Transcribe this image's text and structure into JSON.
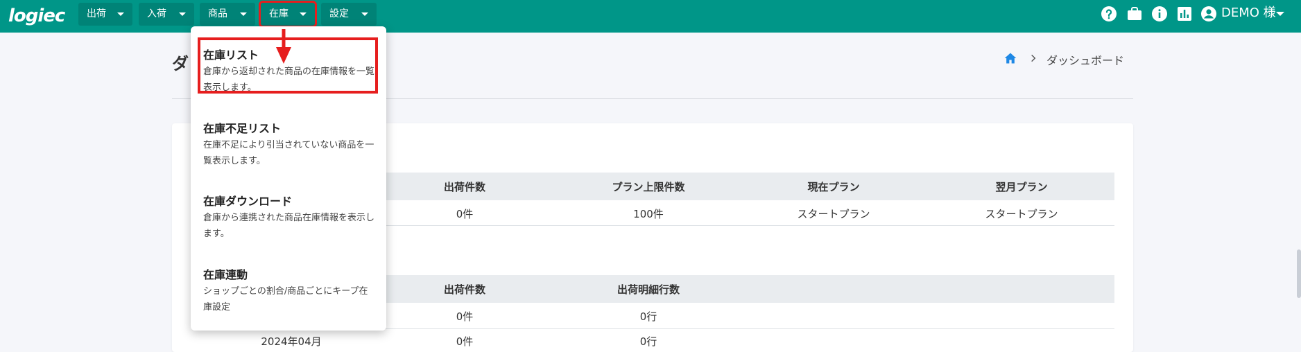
{
  "brand": {
    "logo_text": "logiec"
  },
  "nav": {
    "items": [
      {
        "label": "出荷"
      },
      {
        "label": "入荷"
      },
      {
        "label": "商品"
      },
      {
        "label": "在庫"
      },
      {
        "label": "設定"
      }
    ]
  },
  "user": {
    "name": "DEMO 様"
  },
  "header": {
    "title_initial": "ダ",
    "breadcrumb_current": "ダッシュボード"
  },
  "table1": {
    "headers": [
      "出荷件数",
      "プラン上限件数",
      "現在プラン",
      "翌月プラン"
    ],
    "row": [
      "0件",
      "100件",
      "スタートプラン",
      "スタートプラン"
    ]
  },
  "table2": {
    "headers": [
      "出荷件数",
      "出荷明細行数"
    ],
    "rows": [
      [
        "0件",
        "0行"
      ],
      [
        "2024年04月",
        "0件",
        "0行"
      ]
    ]
  },
  "dropdown": {
    "items": [
      {
        "title": "在庫リスト",
        "desc": "倉庫から返却された商品の在庫情報を一覧表示します。"
      },
      {
        "title": "在庫不足リスト",
        "desc": "在庫不足により引当されていない商品を一覧表示します。"
      },
      {
        "title": "在庫ダウンロード",
        "desc": "倉庫から連携された商品在庫情報を表示します。"
      },
      {
        "title": "在庫連動",
        "desc": "ショップごとの割合/商品ごとにキープ在庫設定"
      }
    ]
  },
  "colors": {
    "topbar": "#009688",
    "highlight": "#e61e1e",
    "home_icon": "#1e88e5"
  },
  "icons": [
    "help-icon",
    "briefcase-icon",
    "info-icon",
    "chart-icon",
    "account-icon",
    "home-icon",
    "chevron-right-icon"
  ]
}
